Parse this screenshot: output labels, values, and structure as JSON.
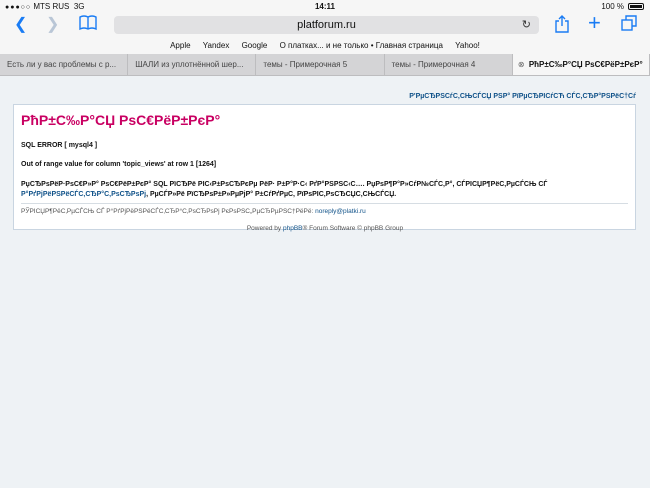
{
  "status_bar": {
    "carrier": "MTS RUS",
    "network": "3G",
    "time": "14:11",
    "battery": "100 %"
  },
  "toolbar": {
    "url": "platforum.ru",
    "back_icon": "chevron-left-icon",
    "forward_icon": "chevron-right-icon",
    "bookmarks_icon": "book-icon",
    "share_icon": "share-icon",
    "new_tab_icon": "plus-icon",
    "tabs_icon": "tabs-icon"
  },
  "bookmarks": [
    "Apple",
    "Yandex",
    "Google",
    "О платках... и не только • Главная страница",
    "Yahoo!"
  ],
  "tabs": [
    {
      "label": "Есть ли у вас проблемы с р..."
    },
    {
      "label": "ШАЛИ из уплотнённой шер..."
    },
    {
      "label": "темы - Примерочная 5"
    },
    {
      "label": "темы - Примерочная 4"
    },
    {
      "label": "РћР±С‰Р°СЏ РѕС€РёР±РєР°"
    }
  ],
  "page": {
    "top_nav": "Р'РµСЂРЅСѓС‚СЊСЃСЏ РЅР° РїРµСЂРІСѓСЋ СЃС‚СЂР°РЅРёС†Сѓ",
    "title": "РћР±С‰Р°СЏ РѕС€РёР±РєР°",
    "sql_error": "SQL ERROR [ mysql4 ]",
    "error_detail": "Out of range value for column 'topic_views' at row 1 [1264]",
    "message_part1": "РџСЂРѕРёР·РѕС€Р»Р° РѕС€РёР±РєР° SQL РїСЂРё РІС‹Р±РѕСЂРєРµ РёР· Р±Р°Р·С‹ РґР°РЅРЅС‹С…. РџРѕР¶Р°Р»СѓР№СЃС‚Р°, СЃРІСЏР¶РёС‚РµСЃСЊ СЃ",
    "message_link": "Р°РґРјРёРЅРёСЃС‚СЂР°С‚РѕСЂРѕРј",
    "message_part2": ", РµСЃР»Рё РїСЂРѕР±Р»РµРјР° Р±СѓРґРµС‚ РїРѕРІС‚РѕСЂСЏС‚СЊСЃСЏ.",
    "contact_label": "РЎРІСЏР¶РёС‚РµСЃСЊ СЃ Р°РґРјРёРЅРёСЃС‚СЂР°С‚РѕСЂРѕРј РєРѕРЅС„РµСЂРµРЅС†РёРё: ",
    "contact_email": "noreply@platki.ru",
    "footer_prefix": "Powered by ",
    "footer_link": "phpBB",
    "footer_suffix": "® Forum Software © phpBB Group"
  }
}
